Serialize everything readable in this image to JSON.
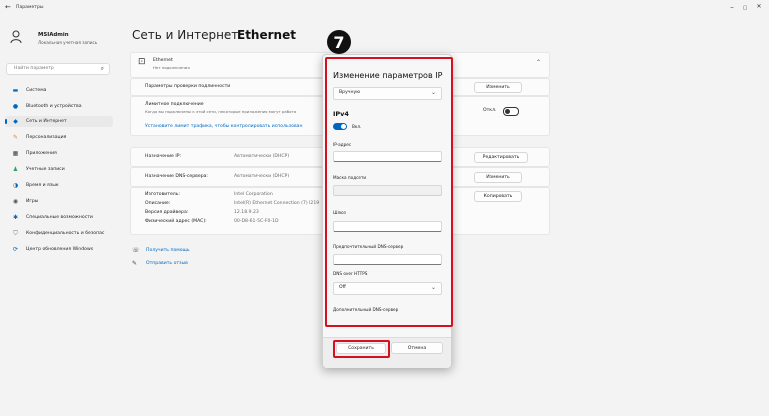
{
  "window": {
    "title": "Параметры",
    "minimize": "–",
    "maximize": "▢",
    "close": "✕",
    "back": "←"
  },
  "user": {
    "name": "MSIAdmin",
    "account_type": "Локальная учетная запись"
  },
  "search": {
    "placeholder": "Найти параметр"
  },
  "sidebar": {
    "items": [
      {
        "label": "Система",
        "icon": "display-icon",
        "color": "#0067c0"
      },
      {
        "label": "Bluetooth и устройства",
        "icon": "bluetooth-icon",
        "color": "#0067c0"
      },
      {
        "label": "Сеть и Интернет",
        "icon": "wifi-icon",
        "color": "#0067c0",
        "active": true
      },
      {
        "label": "Персонализация",
        "icon": "brush-icon",
        "color": "#d98a2b"
      },
      {
        "label": "Приложения",
        "icon": "apps-icon",
        "color": "#444444"
      },
      {
        "label": "Учетные записи",
        "icon": "person-icon",
        "color": "#2aa15a"
      },
      {
        "label": "Время и язык",
        "icon": "globe-clock-icon",
        "color": "#0067c0"
      },
      {
        "label": "Игры",
        "icon": "gamepad-icon",
        "color": "#555555"
      },
      {
        "label": "Специальные возможности",
        "icon": "accessibility-icon",
        "color": "#0067c0"
      },
      {
        "label": "Конфиденциальность и безопас",
        "icon": "shield-icon",
        "color": "#6b6b6b"
      },
      {
        "label": "Центр обновления Windows",
        "icon": "update-icon",
        "color": "#0067c0"
      }
    ]
  },
  "header": {
    "parent": "Сеть и Интернет",
    "separator": "›",
    "current": "Ethernet"
  },
  "adapter": {
    "name": "Ethernet",
    "status": "Нет подключения"
  },
  "auth": {
    "label": "Параметры проверки подлинности",
    "button": "Изменить"
  },
  "metered": {
    "label": "Лимитное подключение",
    "desc": "Когда вы подключены к этой сети, некоторые приложения могут работа",
    "toggle": "Откл.",
    "link": "Установите лимит трафика, чтобы контролировать использован"
  },
  "ip_assign": {
    "label": "Назначение IP:",
    "value": "Автоматически (DHCP)",
    "button": "Редактировать"
  },
  "dns_assign": {
    "label": "Назначение DNS-сервера:",
    "value": "Автоматически (DHCP)",
    "button": "Изменить"
  },
  "details": {
    "rows": [
      {
        "label": "Изготовитель:",
        "value": "Intel Corporation"
      },
      {
        "label": "Описание:",
        "value": "Intel(R) Ethernet Connection (7) I219"
      },
      {
        "label": "Версия драйвера:",
        "value": "12.18.9.23"
      },
      {
        "label": "Физический адрес (MAC):",
        "value": "00-D8-61-5C-F0-1D"
      }
    ],
    "button": "Копировать"
  },
  "help": {
    "get_help": "Получить помощь",
    "feedback": "Отправить отзыв"
  },
  "dialog": {
    "badge": "7",
    "title": "Изменение параметров IP",
    "mode": "Вручную",
    "ipv4": "IPv4",
    "ipv4_toggle": "Вкл.",
    "ip_label": "IP-адрес",
    "mask_label": "Маска подсети",
    "gateway_label": "Шлюз",
    "dns_pref_label": "Предпочтительный DNS-сервер",
    "doh_label": "DNS over HTTPS",
    "doh_value": "Off",
    "dns_alt_label": "Дополнительный DNS-сервер",
    "save": "Сохранить",
    "cancel": "Отмена",
    "accent": "#0067c0",
    "highlight_color": "#d6101f"
  }
}
